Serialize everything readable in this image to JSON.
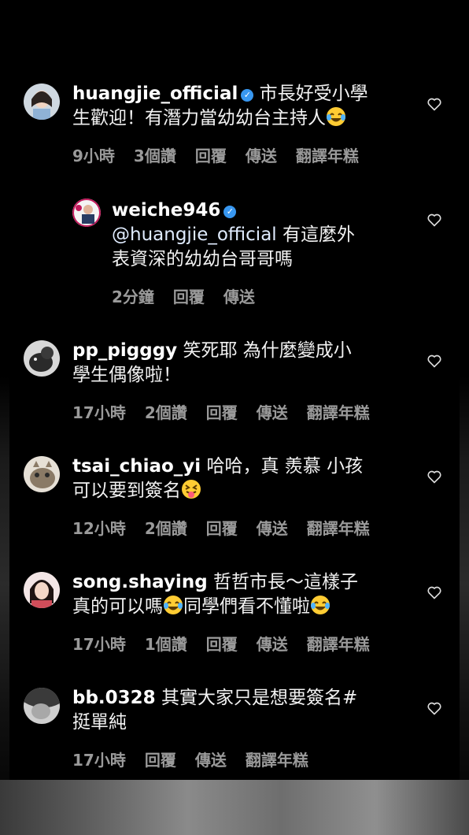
{
  "comments": [
    {
      "username": "huangjie_official",
      "verified": true,
      "text_line1": "市長好受小學",
      "text_line2": "生歡迎！有潛力當幼幼台主持人",
      "emoji": "tears-of-joy",
      "time": "9小時",
      "likes": "3個讚",
      "reply": "回覆",
      "send": "傳送",
      "translate": "翻譯年糕"
    },
    {
      "username": "weiche946",
      "verified": true,
      "mention": "@huangjie_official",
      "text_line1": "有這麼外",
      "text_line2": "表資深的幼幼台哥哥嗎",
      "time": "2分鐘",
      "reply": "回覆",
      "send": "傳送"
    },
    {
      "username": "pp_pigggy",
      "text_line1": "笑死耶 為什麼變成小",
      "text_line2": "學生偶像啦！",
      "time": "17小時",
      "likes": "2個讚",
      "reply": "回覆",
      "send": "傳送",
      "translate": "翻譯年糕"
    },
    {
      "username": "tsai_chiao_yi",
      "text_line1": "哈哈，真 羨慕 小孩",
      "text_line2": "可以要到簽名",
      "emoji": "tongue-out",
      "time": "12小時",
      "likes": "2個讚",
      "reply": "回覆",
      "send": "傳送",
      "translate": "翻譯年糕"
    },
    {
      "username": "song.shaying",
      "text_line1": "哲哲市長～這樣子",
      "text_line2a": "真的可以嗎",
      "text_line2b": "同學們看不懂啦",
      "emoji": "tears-of-joy",
      "time": "17小時",
      "likes": "1個讚",
      "reply": "回覆",
      "send": "傳送",
      "translate": "翻譯年糕"
    },
    {
      "username": "bb.0328",
      "text_line1": "其實大家只是想要簽名#",
      "text_line2": "挺單純",
      "time": "17小時",
      "reply": "回覆",
      "send": "傳送",
      "translate": "翻譯年糕"
    }
  ],
  "colors": {
    "background": "#000000",
    "text": "#f2f2f2",
    "meta": "#9a9a9a",
    "verified": "#3897f0"
  },
  "icons": {
    "like": "heart-outline-icon",
    "verified": "verified-badge-icon"
  }
}
